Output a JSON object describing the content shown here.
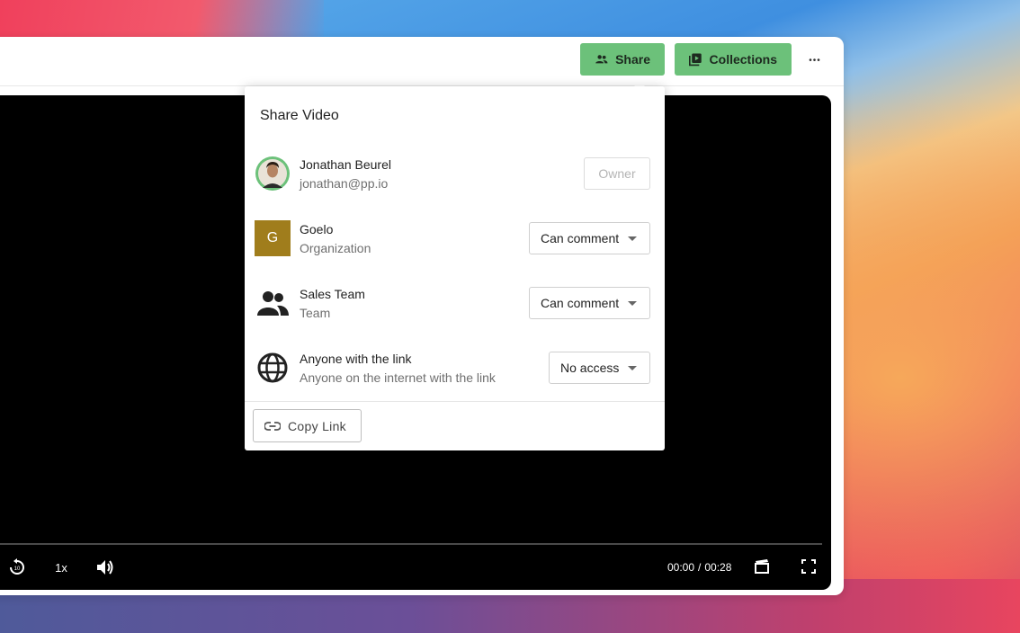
{
  "toolbar": {
    "share_label": "Share",
    "collections_label": "Collections",
    "more_label": "•••"
  },
  "player": {
    "speed": "1x",
    "time_current": "00:00",
    "time_separator": "/",
    "time_total": "00:28",
    "rewind_badge": "10"
  },
  "share_dialog": {
    "title": "Share Video",
    "entries": [
      {
        "name": "Jonathan Beurel",
        "subtitle": "jonathan@pp.io",
        "role": "Owner"
      },
      {
        "name": "Goelo",
        "subtitle": "Organization",
        "initial": "G",
        "role": "Can comment"
      },
      {
        "name": "Sales Team",
        "subtitle": "Team",
        "role": "Can comment"
      },
      {
        "name": "Anyone with the link",
        "subtitle": "Anyone on the internet with the link",
        "role": "No access"
      }
    ],
    "copy_link_label": "Copy Link"
  },
  "colors": {
    "accent_green": "#6cc17a",
    "org_avatar": "#a07d1c",
    "owner_ring": "#6cc17a"
  }
}
